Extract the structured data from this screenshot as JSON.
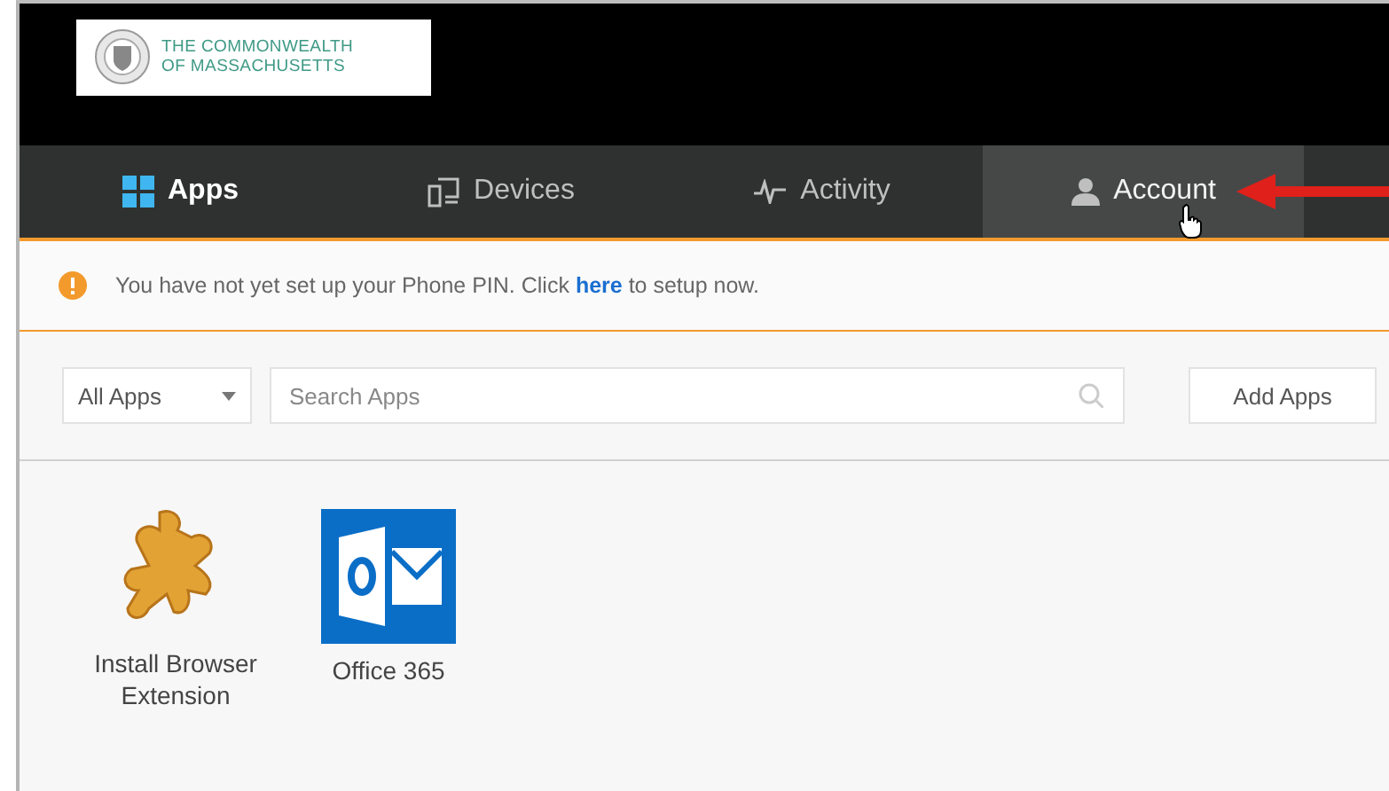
{
  "header": {
    "logo_lines": [
      "THE COMMONWEALTH",
      "OF MASSACHUSETTS"
    ]
  },
  "tabs": [
    {
      "label": "Apps",
      "kind": "apps",
      "selected": true,
      "hovered": false
    },
    {
      "label": "Devices",
      "kind": "devices",
      "selected": false,
      "hovered": false
    },
    {
      "label": "Activity",
      "kind": "activity",
      "selected": false,
      "hovered": false
    },
    {
      "label": "Account",
      "kind": "account",
      "selected": false,
      "hovered": true
    }
  ],
  "alert": {
    "text_before": "You have not yet set up your Phone PIN. Click",
    "link": "here",
    "text_after": "to setup now."
  },
  "toolbar": {
    "filter": "All Apps",
    "search": {
      "placeholder": "Search Apps"
    },
    "add_button": "Add Apps"
  },
  "apps": [
    {
      "name": "Install Browser Extension",
      "kind": "extension"
    },
    {
      "name": "Office 365",
      "kind": "office"
    }
  ]
}
